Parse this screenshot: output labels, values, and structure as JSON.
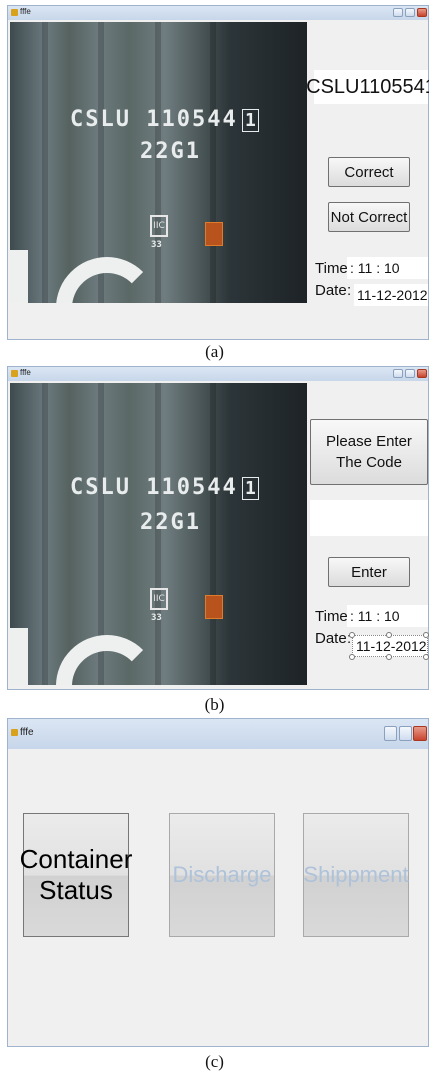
{
  "panel_a": {
    "window_title": "fffe",
    "plate_line1": "CSLU 110544",
    "plate_check": "1",
    "plate_line2": "22G1",
    "logo_text": "IIC",
    "logo_sub": "33",
    "code_display": "CSLU1105541",
    "correct_button": "Correct",
    "not_correct_button": "Not Correct",
    "time_label": "Time",
    "time_value": ": 11 : 10",
    "date_label": "Date",
    "date_value": "11-12-2012",
    "date_colon": ":",
    "caption": "(a)"
  },
  "panel_b": {
    "window_title": "fffe",
    "plate_line1": "CSLU 110544",
    "plate_check": "1",
    "plate_line2": "22G1",
    "logo_text": "IIC",
    "logo_sub": "33",
    "prompt_button": "Please Enter The Code",
    "code_input": "",
    "enter_button": "Enter",
    "time_label": "Time",
    "time_value": ": 11 : 10",
    "date_label": "Date",
    "date_value": "11-12-2012",
    "date_colon": ":",
    "caption": "(b)"
  },
  "panel_c": {
    "window_title": "fffe",
    "container_status_button": "Container Status",
    "discharge_button": "Discharge",
    "shippment_button": "Shippment",
    "caption": "(c)"
  },
  "colors": {
    "window_bg": "#f0f0f0",
    "titlebar": "#c7d6ea",
    "close_button": "#c8452e",
    "disabled_text": "#aec2d9",
    "container_orange": "#b9531d"
  }
}
